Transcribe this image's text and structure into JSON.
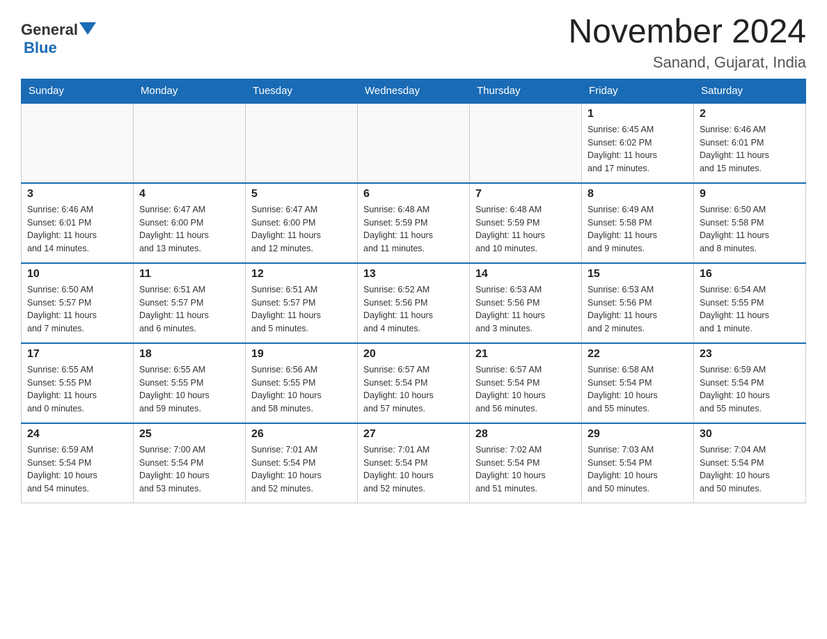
{
  "header": {
    "logo_general": "General",
    "logo_blue": "Blue",
    "month_title": "November 2024",
    "location": "Sanand, Gujarat, India"
  },
  "weekdays": [
    "Sunday",
    "Monday",
    "Tuesday",
    "Wednesday",
    "Thursday",
    "Friday",
    "Saturday"
  ],
  "weeks": [
    [
      {
        "day": "",
        "info": ""
      },
      {
        "day": "",
        "info": ""
      },
      {
        "day": "",
        "info": ""
      },
      {
        "day": "",
        "info": ""
      },
      {
        "day": "",
        "info": ""
      },
      {
        "day": "1",
        "info": "Sunrise: 6:45 AM\nSunset: 6:02 PM\nDaylight: 11 hours\nand 17 minutes."
      },
      {
        "day": "2",
        "info": "Sunrise: 6:46 AM\nSunset: 6:01 PM\nDaylight: 11 hours\nand 15 minutes."
      }
    ],
    [
      {
        "day": "3",
        "info": "Sunrise: 6:46 AM\nSunset: 6:01 PM\nDaylight: 11 hours\nand 14 minutes."
      },
      {
        "day": "4",
        "info": "Sunrise: 6:47 AM\nSunset: 6:00 PM\nDaylight: 11 hours\nand 13 minutes."
      },
      {
        "day": "5",
        "info": "Sunrise: 6:47 AM\nSunset: 6:00 PM\nDaylight: 11 hours\nand 12 minutes."
      },
      {
        "day": "6",
        "info": "Sunrise: 6:48 AM\nSunset: 5:59 PM\nDaylight: 11 hours\nand 11 minutes."
      },
      {
        "day": "7",
        "info": "Sunrise: 6:48 AM\nSunset: 5:59 PM\nDaylight: 11 hours\nand 10 minutes."
      },
      {
        "day": "8",
        "info": "Sunrise: 6:49 AM\nSunset: 5:58 PM\nDaylight: 11 hours\nand 9 minutes."
      },
      {
        "day": "9",
        "info": "Sunrise: 6:50 AM\nSunset: 5:58 PM\nDaylight: 11 hours\nand 8 minutes."
      }
    ],
    [
      {
        "day": "10",
        "info": "Sunrise: 6:50 AM\nSunset: 5:57 PM\nDaylight: 11 hours\nand 7 minutes."
      },
      {
        "day": "11",
        "info": "Sunrise: 6:51 AM\nSunset: 5:57 PM\nDaylight: 11 hours\nand 6 minutes."
      },
      {
        "day": "12",
        "info": "Sunrise: 6:51 AM\nSunset: 5:57 PM\nDaylight: 11 hours\nand 5 minutes."
      },
      {
        "day": "13",
        "info": "Sunrise: 6:52 AM\nSunset: 5:56 PM\nDaylight: 11 hours\nand 4 minutes."
      },
      {
        "day": "14",
        "info": "Sunrise: 6:53 AM\nSunset: 5:56 PM\nDaylight: 11 hours\nand 3 minutes."
      },
      {
        "day": "15",
        "info": "Sunrise: 6:53 AM\nSunset: 5:56 PM\nDaylight: 11 hours\nand 2 minutes."
      },
      {
        "day": "16",
        "info": "Sunrise: 6:54 AM\nSunset: 5:55 PM\nDaylight: 11 hours\nand 1 minute."
      }
    ],
    [
      {
        "day": "17",
        "info": "Sunrise: 6:55 AM\nSunset: 5:55 PM\nDaylight: 11 hours\nand 0 minutes."
      },
      {
        "day": "18",
        "info": "Sunrise: 6:55 AM\nSunset: 5:55 PM\nDaylight: 10 hours\nand 59 minutes."
      },
      {
        "day": "19",
        "info": "Sunrise: 6:56 AM\nSunset: 5:55 PM\nDaylight: 10 hours\nand 58 minutes."
      },
      {
        "day": "20",
        "info": "Sunrise: 6:57 AM\nSunset: 5:54 PM\nDaylight: 10 hours\nand 57 minutes."
      },
      {
        "day": "21",
        "info": "Sunrise: 6:57 AM\nSunset: 5:54 PM\nDaylight: 10 hours\nand 56 minutes."
      },
      {
        "day": "22",
        "info": "Sunrise: 6:58 AM\nSunset: 5:54 PM\nDaylight: 10 hours\nand 55 minutes."
      },
      {
        "day": "23",
        "info": "Sunrise: 6:59 AM\nSunset: 5:54 PM\nDaylight: 10 hours\nand 55 minutes."
      }
    ],
    [
      {
        "day": "24",
        "info": "Sunrise: 6:59 AM\nSunset: 5:54 PM\nDaylight: 10 hours\nand 54 minutes."
      },
      {
        "day": "25",
        "info": "Sunrise: 7:00 AM\nSunset: 5:54 PM\nDaylight: 10 hours\nand 53 minutes."
      },
      {
        "day": "26",
        "info": "Sunrise: 7:01 AM\nSunset: 5:54 PM\nDaylight: 10 hours\nand 52 minutes."
      },
      {
        "day": "27",
        "info": "Sunrise: 7:01 AM\nSunset: 5:54 PM\nDaylight: 10 hours\nand 52 minutes."
      },
      {
        "day": "28",
        "info": "Sunrise: 7:02 AM\nSunset: 5:54 PM\nDaylight: 10 hours\nand 51 minutes."
      },
      {
        "day": "29",
        "info": "Sunrise: 7:03 AM\nSunset: 5:54 PM\nDaylight: 10 hours\nand 50 minutes."
      },
      {
        "day": "30",
        "info": "Sunrise: 7:04 AM\nSunset: 5:54 PM\nDaylight: 10 hours\nand 50 minutes."
      }
    ]
  ]
}
